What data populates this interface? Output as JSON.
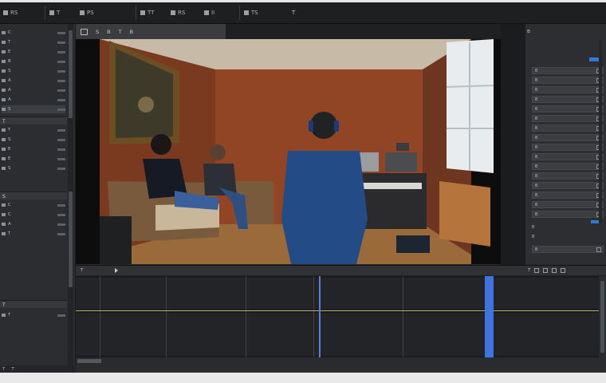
{
  "menubar": {
    "items": [
      "RS",
      "T",
      "PS",
      "TT",
      "RS",
      "II",
      "TS"
    ],
    "right_title": "T"
  },
  "left_panel": {
    "items": [
      "C",
      "T",
      "E",
      "B",
      "S",
      "A",
      "A",
      "A",
      "S",
      "T",
      "S",
      "E",
      "E",
      "S",
      "C",
      "C",
      "A",
      "T",
      "T"
    ],
    "sections": [
      "T",
      "S",
      "T"
    ],
    "footer": [
      "T",
      "T"
    ]
  },
  "viewer_toolbar": {
    "buttons": [
      "S",
      "B",
      "T",
      "B"
    ]
  },
  "right_panel": {
    "header": "B",
    "rows": [
      "B",
      "B",
      "B",
      "B",
      "B",
      "B",
      "B",
      "B",
      "B",
      "B",
      "B",
      "B",
      "B",
      "B",
      "B",
      "B",
      "B"
    ],
    "footer": [
      "B",
      "B"
    ],
    "accent_color": "#2e7bd6"
  },
  "timeline": {
    "header_label": "T",
    "right_label": "T",
    "playhead_color": "#5b7fd9",
    "marker_color": "#3f73e0"
  }
}
